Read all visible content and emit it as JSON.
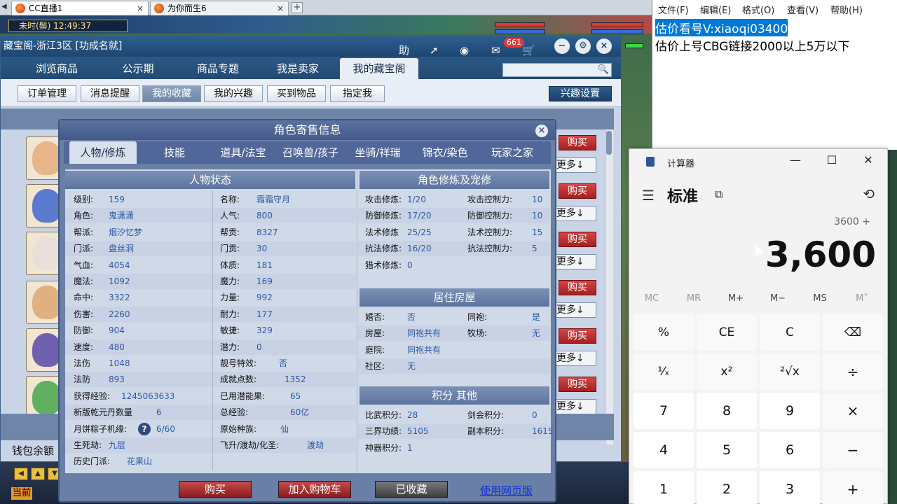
{
  "browser_tabs": [
    {
      "label": "CC直播1",
      "close": "×"
    },
    {
      "label": "为你而生6",
      "close": "×"
    }
  ],
  "browser_new_tab": "+",
  "game_time": "未时(鬃) 12:49:37",
  "cbg": {
    "title": "藏宝阁-浙江3区 [功成名就]",
    "title_help": "助",
    "badge_count": "661",
    "main_tabs": [
      "浏览商品",
      "公示期",
      "商品专题",
      "我是卖家",
      "我的藏宝阁"
    ],
    "sub_tabs": [
      "订单管理",
      "消息提醒",
      "我的收藏",
      "我的兴趣",
      "买到物品",
      "指定我"
    ],
    "interest_settings": "兴趣设置",
    "row_buy": "购买",
    "row_more": "更多↓",
    "wallet_label": "钱包余额"
  },
  "dialog": {
    "title": "角色寄售信息",
    "close": "×",
    "tabs": [
      "人物/修炼",
      "技能",
      "道具/法宝",
      "召唤兽/孩子",
      "坐骑/祥瑞",
      "锦衣/染色",
      "玩家之家"
    ],
    "status": {
      "title": "人物状态",
      "left": [
        {
          "k": "级别:",
          "v": "159"
        },
        {
          "k": "角色:",
          "v": "鬼潇潇"
        },
        {
          "k": "帮派:",
          "v": "烟汐忆梦"
        },
        {
          "k": "门派:",
          "v": "盘丝洞"
        },
        {
          "k": "气血:",
          "v": "4054"
        },
        {
          "k": "魔法:",
          "v": "1092"
        },
        {
          "k": "命中:",
          "v": "3322"
        },
        {
          "k": "伤害:",
          "v": "2260"
        },
        {
          "k": "防御:",
          "v": "904"
        },
        {
          "k": "速度:",
          "v": "480"
        },
        {
          "k": "法伤",
          "v": "1048"
        },
        {
          "k": "法防",
          "v": "893"
        },
        {
          "k": "获得经验:",
          "v": "1245063633"
        },
        {
          "k": "新版乾元丹数量",
          "v": "6"
        },
        {
          "k": "月饼粽子机缘:",
          "v": "6/60"
        },
        {
          "k": "生死劫:",
          "v": "九层"
        },
        {
          "k": "历史门派:",
          "v": "花果山"
        }
      ],
      "right": [
        {
          "k": "名称:",
          "v": "霜霜守月"
        },
        {
          "k": "人气:",
          "v": "800"
        },
        {
          "k": "帮贡:",
          "v": "8327"
        },
        {
          "k": "门贡:",
          "v": "30"
        },
        {
          "k": "体质:",
          "v": "181"
        },
        {
          "k": "魔力:",
          "v": "169"
        },
        {
          "k": "力量:",
          "v": "992"
        },
        {
          "k": "耐力:",
          "v": "177"
        },
        {
          "k": "敏捷:",
          "v": "329"
        },
        {
          "k": "潜力:",
          "v": "0"
        },
        {
          "k": "靓号特效:",
          "v": "否"
        },
        {
          "k": "成就点数:",
          "v": "1352"
        },
        {
          "k": "已用潜能果:",
          "v": "65"
        },
        {
          "k": "总经验:",
          "v": "60亿"
        },
        {
          "k": "原始种族:",
          "v": "仙"
        },
        {
          "k": "飞升/渡劫/化圣:",
          "v": "渡劫"
        }
      ],
      "qmark": "?"
    },
    "cultivation": {
      "title": "角色修炼及宠修",
      "rows": [
        {
          "k1": "攻击修炼:",
          "v1": "1/20",
          "k2": "攻击控制力:",
          "v2": "10"
        },
        {
          "k1": "防御修炼:",
          "v1": "17/20",
          "k2": "防御控制力:",
          "v2": "10"
        },
        {
          "k1": "法术修炼",
          "v1": "25/25",
          "k2": "法术控制力:",
          "v2": "15"
        },
        {
          "k1": "抗法修炼:",
          "v1": "16/20",
          "k2": "抗法控制力:",
          "v2": "5"
        },
        {
          "k1": "猎术修炼:",
          "v1": "0",
          "k2": "",
          "v2": ""
        }
      ]
    },
    "housing": {
      "title": "居住房屋",
      "rows": [
        {
          "k1": "婚否:",
          "v1": "否",
          "k2": "同袍:",
          "v2": "是"
        },
        {
          "k1": "房屋:",
          "v1": "同袍共有",
          "k2": "牧场:",
          "v2": "无"
        },
        {
          "k1": "庭院:",
          "v1": "同袍共有",
          "k2": "",
          "v2": ""
        },
        {
          "k1": "社区:",
          "v1": "无",
          "k2": "",
          "v2": ""
        }
      ]
    },
    "points": {
      "title": "积分 其他",
      "rows": [
        {
          "k1": "比武积分:",
          "v1": "28",
          "k2": "剑会积分:",
          "v2": "0"
        },
        {
          "k1": "三界功绩:",
          "v1": "5105",
          "k2": "副本积分:",
          "v2": "1615"
        },
        {
          "k1": "神器积分:",
          "v1": "1",
          "k2": "",
          "v2": ""
        }
      ]
    },
    "buttons": {
      "buy": "购买",
      "add_cart": "加入购物车",
      "favorited": "已收藏",
      "web_link": "使用网页版"
    }
  },
  "game_bottom": {
    "current_tab": "当前"
  },
  "notepad": {
    "menu": [
      "文件(F)",
      "编辑(E)",
      "格式(O)",
      "查看(V)",
      "帮助(H)"
    ],
    "lines": [
      "估价看号V:xiaoqi03400",
      "估价上号CBG链接2000以上5万以下"
    ]
  },
  "calculator": {
    "title": "计算器",
    "mode": "标准",
    "expression": "3600 +",
    "display": "3,600",
    "memory": [
      "MC",
      "MR",
      "M+",
      "M−",
      "MS",
      "M˅"
    ],
    "keys": [
      "%",
      "CE",
      "C",
      "⌫",
      "¹⁄ₓ",
      "x²",
      "²√x",
      "÷",
      "7",
      "8",
      "9",
      "×",
      "4",
      "5",
      "6",
      "−",
      "1",
      "2",
      "3",
      "+"
    ],
    "window_buttons": [
      "—",
      "☐",
      "✕"
    ]
  }
}
